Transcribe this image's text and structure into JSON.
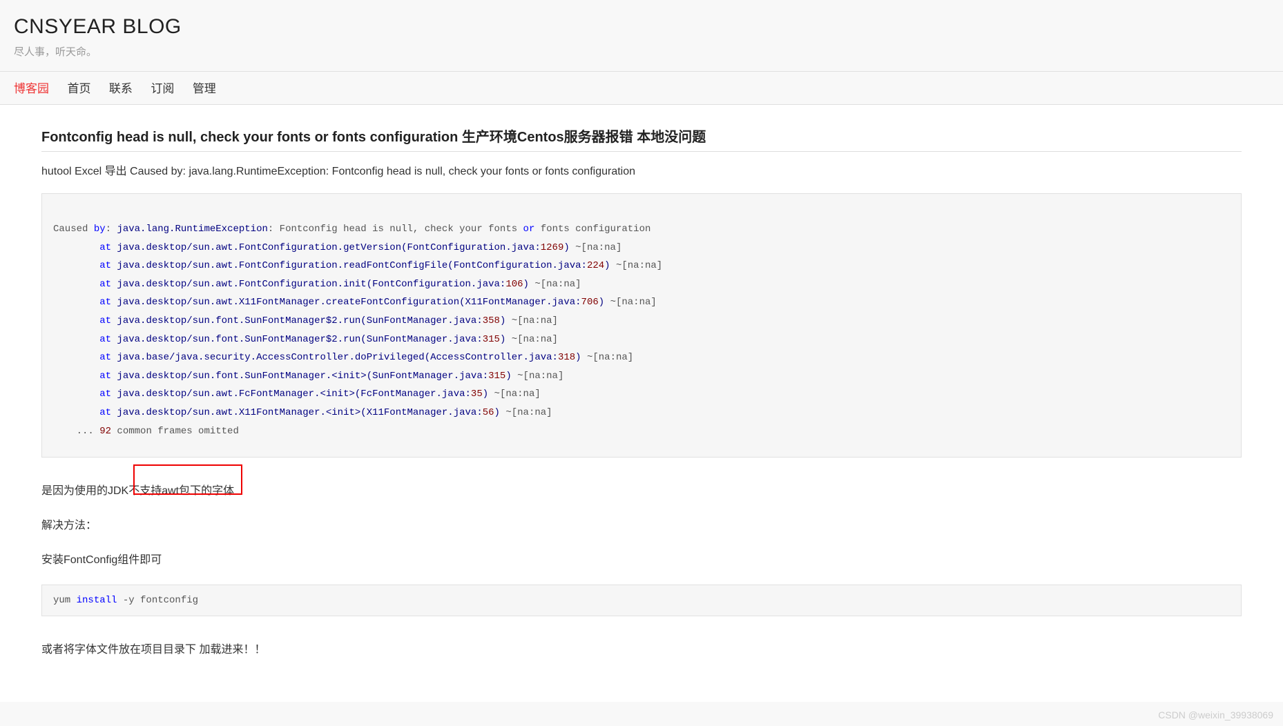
{
  "header": {
    "title": "CNSYEAR BLOG",
    "subtitle": "尽人事，听天命。"
  },
  "nav": {
    "items": [
      "博客园",
      "首页",
      "联系",
      "订阅",
      "管理"
    ]
  },
  "post": {
    "title": "Fontconfig head is null, check your fonts or fonts configuration 生产环境Centos服务器报错 本地没问题",
    "intro": "hutool Excel 导出 Caused by: java.lang.RuntimeException: Fontconfig head is null, check your fonts or fonts configuration",
    "stack": {
      "caused": "Caused ",
      "by": "by",
      "colon": ": ",
      "exc": "java.lang.RuntimeException",
      "msg": ": Fontconfig head is null, check your fonts ",
      "or": "or",
      "msg2": " fonts configuration",
      "lines": [
        {
          "at": "at",
          "loc": " java.desktop/sun.awt.FontConfiguration.getVersion(FontConfiguration.java:",
          "ln": "1269",
          "tail": ") ~[na:na]"
        },
        {
          "at": "at",
          "loc": " java.desktop/sun.awt.FontConfiguration.readFontConfigFile(FontConfiguration.java:",
          "ln": "224",
          "tail": ") ~[na:na]"
        },
        {
          "at": "at",
          "loc": " java.desktop/sun.awt.FontConfiguration.init(FontConfiguration.java:",
          "ln": "106",
          "tail": ") ~[na:na]"
        },
        {
          "at": "at",
          "loc": " java.desktop/sun.awt.X11FontManager.createFontConfiguration(X11FontManager.java:",
          "ln": "706",
          "tail": ") ~[na:na]"
        },
        {
          "at": "at",
          "loc": " java.desktop/sun.font.SunFontManager$2.run(SunFontManager.java:",
          "ln": "358",
          "tail": ") ~[na:na]"
        },
        {
          "at": "at",
          "loc": " java.desktop/sun.font.SunFontManager$2.run(SunFontManager.java:",
          "ln": "315",
          "tail": ") ~[na:na]"
        },
        {
          "at": "at",
          "loc": " java.base/java.security.AccessController.doPrivileged(AccessController.java:",
          "ln": "318",
          "tail": ") ~[na:na]"
        },
        {
          "at": "at",
          "loc": " java.desktop/sun.font.SunFontManager.<init>(SunFontManager.java:",
          "ln": "315",
          "tail": ") ~[na:na]"
        },
        {
          "at": "at",
          "loc": " java.desktop/sun.awt.FcFontManager.<init>(FcFontManager.java:",
          "ln": "35",
          "tail": ") ~[na:na]"
        },
        {
          "at": "at",
          "loc": " java.desktop/sun.awt.X11FontManager.<init>(X11FontManager.java:",
          "ln": "56",
          "tail": ") ~[na:na]"
        }
      ],
      "omit_pre": "    ... ",
      "omit_n": "92",
      "omit_post": " common frames omitted"
    },
    "reason": "是因为使用的JDK不支持awt包下的字体",
    "solution_label": "解决方法：",
    "solution_text": "安装FontConfig组件即可",
    "cmd": {
      "pre": "yum ",
      "kw": "install",
      "post": " -y fontconfig"
    },
    "alt": "或者将字体文件放在项目目录下 加载进来！！"
  },
  "watermark": "CSDN @weixin_39938069"
}
